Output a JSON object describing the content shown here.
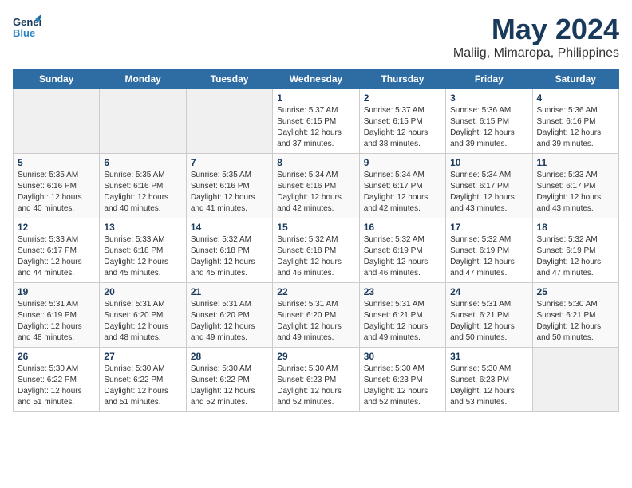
{
  "logo": {
    "line1": "General",
    "line2": "Blue"
  },
  "header": {
    "title": "May 2024",
    "subtitle": "Maliig, Mimaropa, Philippines"
  },
  "weekdays": [
    "Sunday",
    "Monday",
    "Tuesday",
    "Wednesday",
    "Thursday",
    "Friday",
    "Saturday"
  ],
  "weeks": [
    [
      {
        "day": "",
        "sunrise": "",
        "sunset": "",
        "daylight": ""
      },
      {
        "day": "",
        "sunrise": "",
        "sunset": "",
        "daylight": ""
      },
      {
        "day": "",
        "sunrise": "",
        "sunset": "",
        "daylight": ""
      },
      {
        "day": "1",
        "sunrise": "Sunrise: 5:37 AM",
        "sunset": "Sunset: 6:15 PM",
        "daylight": "Daylight: 12 hours and 37 minutes."
      },
      {
        "day": "2",
        "sunrise": "Sunrise: 5:37 AM",
        "sunset": "Sunset: 6:15 PM",
        "daylight": "Daylight: 12 hours and 38 minutes."
      },
      {
        "day": "3",
        "sunrise": "Sunrise: 5:36 AM",
        "sunset": "Sunset: 6:15 PM",
        "daylight": "Daylight: 12 hours and 39 minutes."
      },
      {
        "day": "4",
        "sunrise": "Sunrise: 5:36 AM",
        "sunset": "Sunset: 6:16 PM",
        "daylight": "Daylight: 12 hours and 39 minutes."
      }
    ],
    [
      {
        "day": "5",
        "sunrise": "Sunrise: 5:35 AM",
        "sunset": "Sunset: 6:16 PM",
        "daylight": "Daylight: 12 hours and 40 minutes."
      },
      {
        "day": "6",
        "sunrise": "Sunrise: 5:35 AM",
        "sunset": "Sunset: 6:16 PM",
        "daylight": "Daylight: 12 hours and 40 minutes."
      },
      {
        "day": "7",
        "sunrise": "Sunrise: 5:35 AM",
        "sunset": "Sunset: 6:16 PM",
        "daylight": "Daylight: 12 hours and 41 minutes."
      },
      {
        "day": "8",
        "sunrise": "Sunrise: 5:34 AM",
        "sunset": "Sunset: 6:16 PM",
        "daylight": "Daylight: 12 hours and 42 minutes."
      },
      {
        "day": "9",
        "sunrise": "Sunrise: 5:34 AM",
        "sunset": "Sunset: 6:17 PM",
        "daylight": "Daylight: 12 hours and 42 minutes."
      },
      {
        "day": "10",
        "sunrise": "Sunrise: 5:34 AM",
        "sunset": "Sunset: 6:17 PM",
        "daylight": "Daylight: 12 hours and 43 minutes."
      },
      {
        "day": "11",
        "sunrise": "Sunrise: 5:33 AM",
        "sunset": "Sunset: 6:17 PM",
        "daylight": "Daylight: 12 hours and 43 minutes."
      }
    ],
    [
      {
        "day": "12",
        "sunrise": "Sunrise: 5:33 AM",
        "sunset": "Sunset: 6:17 PM",
        "daylight": "Daylight: 12 hours and 44 minutes."
      },
      {
        "day": "13",
        "sunrise": "Sunrise: 5:33 AM",
        "sunset": "Sunset: 6:18 PM",
        "daylight": "Daylight: 12 hours and 45 minutes."
      },
      {
        "day": "14",
        "sunrise": "Sunrise: 5:32 AM",
        "sunset": "Sunset: 6:18 PM",
        "daylight": "Daylight: 12 hours and 45 minutes."
      },
      {
        "day": "15",
        "sunrise": "Sunrise: 5:32 AM",
        "sunset": "Sunset: 6:18 PM",
        "daylight": "Daylight: 12 hours and 46 minutes."
      },
      {
        "day": "16",
        "sunrise": "Sunrise: 5:32 AM",
        "sunset": "Sunset: 6:19 PM",
        "daylight": "Daylight: 12 hours and 46 minutes."
      },
      {
        "day": "17",
        "sunrise": "Sunrise: 5:32 AM",
        "sunset": "Sunset: 6:19 PM",
        "daylight": "Daylight: 12 hours and 47 minutes."
      },
      {
        "day": "18",
        "sunrise": "Sunrise: 5:32 AM",
        "sunset": "Sunset: 6:19 PM",
        "daylight": "Daylight: 12 hours and 47 minutes."
      }
    ],
    [
      {
        "day": "19",
        "sunrise": "Sunrise: 5:31 AM",
        "sunset": "Sunset: 6:19 PM",
        "daylight": "Daylight: 12 hours and 48 minutes."
      },
      {
        "day": "20",
        "sunrise": "Sunrise: 5:31 AM",
        "sunset": "Sunset: 6:20 PM",
        "daylight": "Daylight: 12 hours and 48 minutes."
      },
      {
        "day": "21",
        "sunrise": "Sunrise: 5:31 AM",
        "sunset": "Sunset: 6:20 PM",
        "daylight": "Daylight: 12 hours and 49 minutes."
      },
      {
        "day": "22",
        "sunrise": "Sunrise: 5:31 AM",
        "sunset": "Sunset: 6:20 PM",
        "daylight": "Daylight: 12 hours and 49 minutes."
      },
      {
        "day": "23",
        "sunrise": "Sunrise: 5:31 AM",
        "sunset": "Sunset: 6:21 PM",
        "daylight": "Daylight: 12 hours and 49 minutes."
      },
      {
        "day": "24",
        "sunrise": "Sunrise: 5:31 AM",
        "sunset": "Sunset: 6:21 PM",
        "daylight": "Daylight: 12 hours and 50 minutes."
      },
      {
        "day": "25",
        "sunrise": "Sunrise: 5:30 AM",
        "sunset": "Sunset: 6:21 PM",
        "daylight": "Daylight: 12 hours and 50 minutes."
      }
    ],
    [
      {
        "day": "26",
        "sunrise": "Sunrise: 5:30 AM",
        "sunset": "Sunset: 6:22 PM",
        "daylight": "Daylight: 12 hours and 51 minutes."
      },
      {
        "day": "27",
        "sunrise": "Sunrise: 5:30 AM",
        "sunset": "Sunset: 6:22 PM",
        "daylight": "Daylight: 12 hours and 51 minutes."
      },
      {
        "day": "28",
        "sunrise": "Sunrise: 5:30 AM",
        "sunset": "Sunset: 6:22 PM",
        "daylight": "Daylight: 12 hours and 52 minutes."
      },
      {
        "day": "29",
        "sunrise": "Sunrise: 5:30 AM",
        "sunset": "Sunset: 6:23 PM",
        "daylight": "Daylight: 12 hours and 52 minutes."
      },
      {
        "day": "30",
        "sunrise": "Sunrise: 5:30 AM",
        "sunset": "Sunset: 6:23 PM",
        "daylight": "Daylight: 12 hours and 52 minutes."
      },
      {
        "day": "31",
        "sunrise": "Sunrise: 5:30 AM",
        "sunset": "Sunset: 6:23 PM",
        "daylight": "Daylight: 12 hours and 53 minutes."
      },
      {
        "day": "",
        "sunrise": "",
        "sunset": "",
        "daylight": ""
      }
    ]
  ]
}
